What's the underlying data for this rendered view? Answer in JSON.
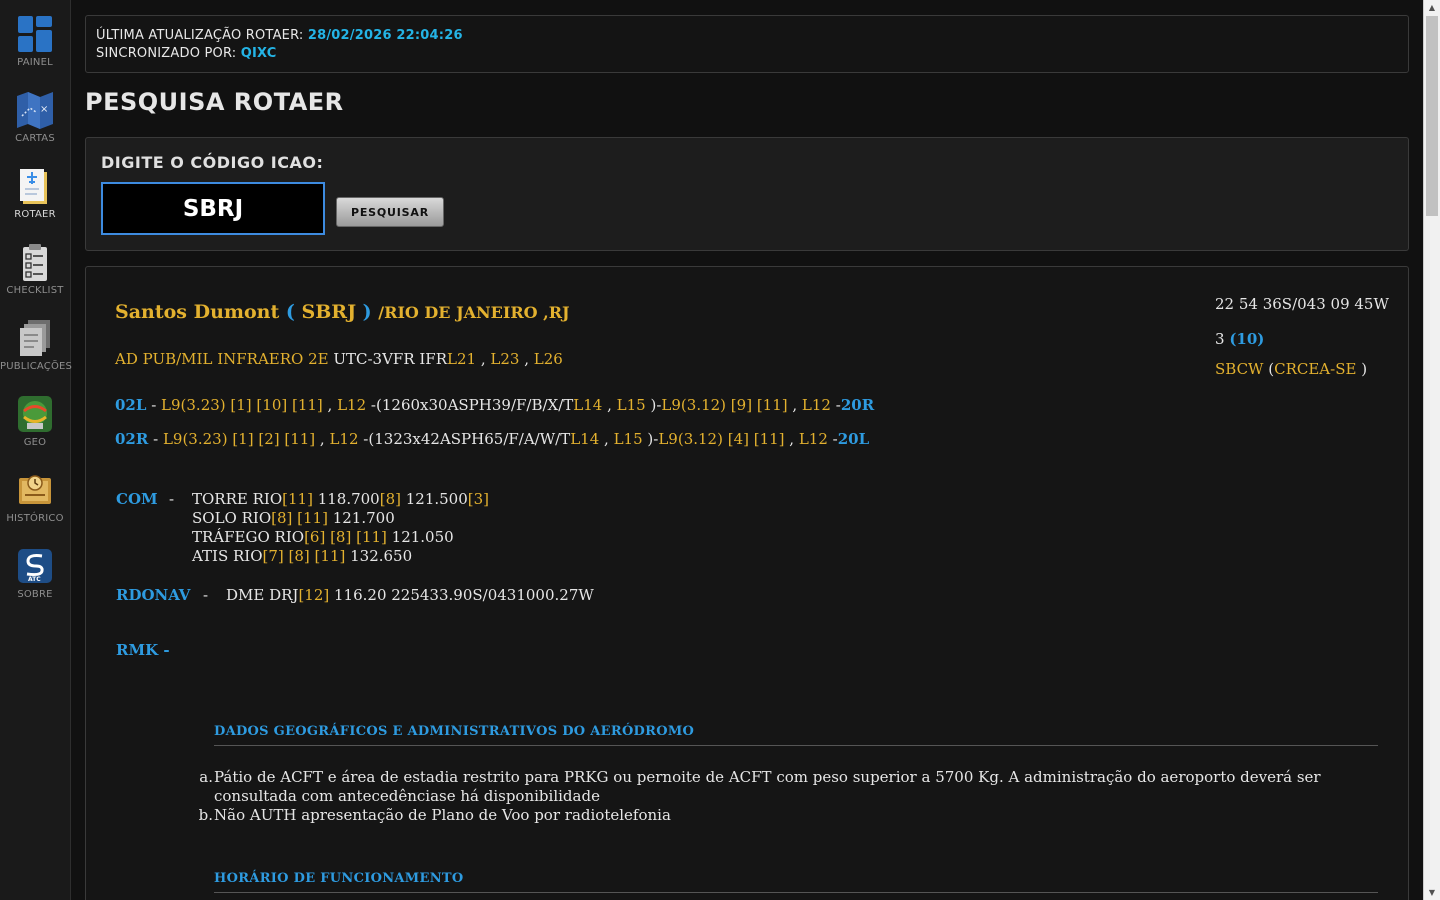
{
  "sidebar": {
    "items": [
      {
        "label": "PAINEL",
        "icon": "grid-dashboard-icon"
      },
      {
        "label": "CARTAS",
        "icon": "map-chart-icon"
      },
      {
        "label": "ROTAER",
        "icon": "document-airplane-icon"
      },
      {
        "label": "CHECKLIST",
        "icon": "checklist-clipboard-icon"
      },
      {
        "label": "PUBLICAÇÕES",
        "icon": "publications-stack-icon"
      },
      {
        "label": "GEO",
        "icon": "geo-globe-logo-icon"
      },
      {
        "label": "HISTÓRICO",
        "icon": "history-clipboard-icon"
      },
      {
        "label": "SOBRE",
        "icon": "atc-logo-icon"
      }
    ],
    "active": "ROTAER"
  },
  "sync": {
    "update_label": "ÚLTIMA ATUALIZAÇÃO ROTAER: ",
    "update_value": "28/02/2026 22:04:26",
    "by_label": "SINCRONIZADO POR: ",
    "by_value": "QIXC"
  },
  "page_title": "PESQUISA ROTAER",
  "search": {
    "label": "DIGITE O CÓDIGO ICAO:",
    "value": "SBRJ",
    "button": "PESQUISAR"
  },
  "result": {
    "name": "Santos Dumont",
    "paren_open": " ( ",
    "icao": "SBRJ",
    "paren_close": "  ) ",
    "city": "/RIO DE JANEIRO ,RJ",
    "type": "AD PUB/MIL INFRAERO 2E",
    "utc": " UTC-3VFR IFR",
    "notes_main": [
      "L21",
      " , ",
      "L23",
      " , ",
      "L26"
    ],
    "coords": "22 54 36S/043 09 45W",
    "elev_value": "3 ",
    "elev_ft": "(10)",
    "fir": "SBCW",
    "fir_region": "CRCEA-SE",
    "runways": [
      {
        "id": "02L",
        "lights_a": "L9(3.23) [1] [10] [11]",
        "l12a": "L12",
        "dims": "(1260x30ASPH39/F/B/X/T",
        "l14": "L14",
        "l15": "L15",
        "lights_b": "L9(3.12) [9] [11]",
        "l12b": "L12",
        "end": "20R"
      },
      {
        "id": "02R",
        "lights_a": "L9(3.23) [1] [2] [11]",
        "l12a": "L12",
        "dims": "(1323x42ASPH65/F/A/W/T",
        "l14": "L14",
        "l15": "L15",
        "lights_b": "L9(3.12) [4] [11]",
        "l12b": "L12",
        "end": "20L"
      }
    ],
    "com_label": "COM",
    "com": [
      {
        "name": "TORRE RIO",
        "notes1": "[11]",
        "freq1": " 118.700",
        "notes2": "[8]",
        "freq2": " 121.500",
        "notes3": "[3]"
      },
      {
        "name": "SOLO RIO",
        "notes1": "[8] [11]",
        "freq1": " 121.700"
      },
      {
        "name": "TRÁFEGO RIO",
        "notes1": "[6] [8] [11]",
        "freq1": " 121.050"
      },
      {
        "name": "ATIS RIO",
        "notes1": "[7] [8] [11]",
        "freq1": " 132.650"
      }
    ],
    "rdonav_label": "RDONAV",
    "rdonav": {
      "name": "DME DRJ",
      "notes": "[12]",
      "data": " 116.20 225433.90S/0431000.27W"
    },
    "rmk_label": "RMK -",
    "sections": [
      {
        "title": "DADOS GEOGRÁFICOS E ADMINISTRATIVOS DO AERÓDROMO",
        "items": [
          {
            "letter": "a.",
            "text": "Pátio de ACFT e área de estadia restrito para PRKG ou pernoite de ACFT com peso superior a 5700 Kg. A administração do aeroporto deverá ser consultada com antecedênciase há disponibilidade"
          },
          {
            "letter": "b.",
            "text": "Não AUTH apresentação de Plano de Voo por radiotelefonia"
          }
        ]
      },
      {
        "title": "HORÁRIO DE FUNCIONAMENTO",
        "items": []
      }
    ]
  }
}
